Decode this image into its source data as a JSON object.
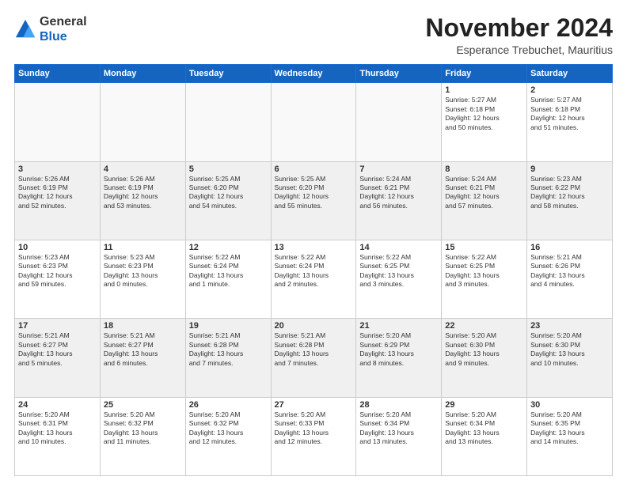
{
  "header": {
    "logo": {
      "line1": "General",
      "line2": "Blue"
    },
    "title": "November 2024",
    "location": "Esperance Trebuchet, Mauritius"
  },
  "weekdays": [
    "Sunday",
    "Monday",
    "Tuesday",
    "Wednesday",
    "Thursday",
    "Friday",
    "Saturday"
  ],
  "weeks": [
    [
      {
        "day": "",
        "info": ""
      },
      {
        "day": "",
        "info": ""
      },
      {
        "day": "",
        "info": ""
      },
      {
        "day": "",
        "info": ""
      },
      {
        "day": "",
        "info": ""
      },
      {
        "day": "1",
        "info": "Sunrise: 5:27 AM\nSunset: 6:18 PM\nDaylight: 12 hours\nand 50 minutes."
      },
      {
        "day": "2",
        "info": "Sunrise: 5:27 AM\nSunset: 6:18 PM\nDaylight: 12 hours\nand 51 minutes."
      }
    ],
    [
      {
        "day": "3",
        "info": "Sunrise: 5:26 AM\nSunset: 6:19 PM\nDaylight: 12 hours\nand 52 minutes."
      },
      {
        "day": "4",
        "info": "Sunrise: 5:26 AM\nSunset: 6:19 PM\nDaylight: 12 hours\nand 53 minutes."
      },
      {
        "day": "5",
        "info": "Sunrise: 5:25 AM\nSunset: 6:20 PM\nDaylight: 12 hours\nand 54 minutes."
      },
      {
        "day": "6",
        "info": "Sunrise: 5:25 AM\nSunset: 6:20 PM\nDaylight: 12 hours\nand 55 minutes."
      },
      {
        "day": "7",
        "info": "Sunrise: 5:24 AM\nSunset: 6:21 PM\nDaylight: 12 hours\nand 56 minutes."
      },
      {
        "day": "8",
        "info": "Sunrise: 5:24 AM\nSunset: 6:21 PM\nDaylight: 12 hours\nand 57 minutes."
      },
      {
        "day": "9",
        "info": "Sunrise: 5:23 AM\nSunset: 6:22 PM\nDaylight: 12 hours\nand 58 minutes."
      }
    ],
    [
      {
        "day": "10",
        "info": "Sunrise: 5:23 AM\nSunset: 6:23 PM\nDaylight: 12 hours\nand 59 minutes."
      },
      {
        "day": "11",
        "info": "Sunrise: 5:23 AM\nSunset: 6:23 PM\nDaylight: 13 hours\nand 0 minutes."
      },
      {
        "day": "12",
        "info": "Sunrise: 5:22 AM\nSunset: 6:24 PM\nDaylight: 13 hours\nand 1 minute."
      },
      {
        "day": "13",
        "info": "Sunrise: 5:22 AM\nSunset: 6:24 PM\nDaylight: 13 hours\nand 2 minutes."
      },
      {
        "day": "14",
        "info": "Sunrise: 5:22 AM\nSunset: 6:25 PM\nDaylight: 13 hours\nand 3 minutes."
      },
      {
        "day": "15",
        "info": "Sunrise: 5:22 AM\nSunset: 6:25 PM\nDaylight: 13 hours\nand 3 minutes."
      },
      {
        "day": "16",
        "info": "Sunrise: 5:21 AM\nSunset: 6:26 PM\nDaylight: 13 hours\nand 4 minutes."
      }
    ],
    [
      {
        "day": "17",
        "info": "Sunrise: 5:21 AM\nSunset: 6:27 PM\nDaylight: 13 hours\nand 5 minutes."
      },
      {
        "day": "18",
        "info": "Sunrise: 5:21 AM\nSunset: 6:27 PM\nDaylight: 13 hours\nand 6 minutes."
      },
      {
        "day": "19",
        "info": "Sunrise: 5:21 AM\nSunset: 6:28 PM\nDaylight: 13 hours\nand 7 minutes."
      },
      {
        "day": "20",
        "info": "Sunrise: 5:21 AM\nSunset: 6:28 PM\nDaylight: 13 hours\nand 7 minutes."
      },
      {
        "day": "21",
        "info": "Sunrise: 5:20 AM\nSunset: 6:29 PM\nDaylight: 13 hours\nand 8 minutes."
      },
      {
        "day": "22",
        "info": "Sunrise: 5:20 AM\nSunset: 6:30 PM\nDaylight: 13 hours\nand 9 minutes."
      },
      {
        "day": "23",
        "info": "Sunrise: 5:20 AM\nSunset: 6:30 PM\nDaylight: 13 hours\nand 10 minutes."
      }
    ],
    [
      {
        "day": "24",
        "info": "Sunrise: 5:20 AM\nSunset: 6:31 PM\nDaylight: 13 hours\nand 10 minutes."
      },
      {
        "day": "25",
        "info": "Sunrise: 5:20 AM\nSunset: 6:32 PM\nDaylight: 13 hours\nand 11 minutes."
      },
      {
        "day": "26",
        "info": "Sunrise: 5:20 AM\nSunset: 6:32 PM\nDaylight: 13 hours\nand 12 minutes."
      },
      {
        "day": "27",
        "info": "Sunrise: 5:20 AM\nSunset: 6:33 PM\nDaylight: 13 hours\nand 12 minutes."
      },
      {
        "day": "28",
        "info": "Sunrise: 5:20 AM\nSunset: 6:34 PM\nDaylight: 13 hours\nand 13 minutes."
      },
      {
        "day": "29",
        "info": "Sunrise: 5:20 AM\nSunset: 6:34 PM\nDaylight: 13 hours\nand 13 minutes."
      },
      {
        "day": "30",
        "info": "Sunrise: 5:20 AM\nSunset: 6:35 PM\nDaylight: 13 hours\nand 14 minutes."
      }
    ]
  ]
}
